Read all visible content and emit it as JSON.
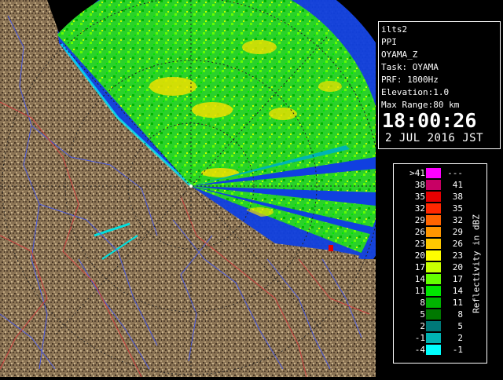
{
  "info": {
    "lines": [
      "ilts2",
      "PPI",
      "OYAMA_Z",
      "Task: OYAMA",
      "PRF: 1800Hz",
      "Elevation:1.0",
      "Max Range:80 km"
    ],
    "time": "18:00:26",
    "date": "2 JUL 2016 JST"
  },
  "legend": {
    "unit_label": "Reflectivity in dBZ",
    "rows": [
      {
        "lo": ">41",
        "hi": "---",
        "color": "#ff00ff"
      },
      {
        "lo": "38",
        "hi": "41",
        "color": "#c80064"
      },
      {
        "lo": "35",
        "hi": "38",
        "color": "#e60000"
      },
      {
        "lo": "32",
        "hi": "35",
        "color": "#ff2800"
      },
      {
        "lo": "29",
        "hi": "32",
        "color": "#ff6400"
      },
      {
        "lo": "26",
        "hi": "29",
        "color": "#ff9600"
      },
      {
        "lo": "23",
        "hi": "26",
        "color": "#ffc800"
      },
      {
        "lo": "20",
        "hi": "23",
        "color": "#ffff00"
      },
      {
        "lo": "17",
        "hi": "20",
        "color": "#c8ff00"
      },
      {
        "lo": "14",
        "hi": "17",
        "color": "#64ff00"
      },
      {
        "lo": "11",
        "hi": "14",
        "color": "#00e600"
      },
      {
        "lo": "8",
        "hi": "11",
        "color": "#00b400"
      },
      {
        "lo": "5",
        "hi": "8",
        "color": "#007800"
      },
      {
        "lo": "2",
        "hi": "5",
        "color": "#007878"
      },
      {
        "lo": "-1",
        "hi": "2",
        "color": "#00b4b4"
      },
      {
        "lo": "-4",
        "hi": "-1",
        "color": "#00ffff"
      }
    ]
  },
  "colors": {
    "sea": "#1040e0",
    "terrain": "#8a7354",
    "echo_green": "#2ad12a",
    "echo_yellow": "#f0e000",
    "rivers": "#4a5ae0",
    "borders": "#d04040"
  }
}
